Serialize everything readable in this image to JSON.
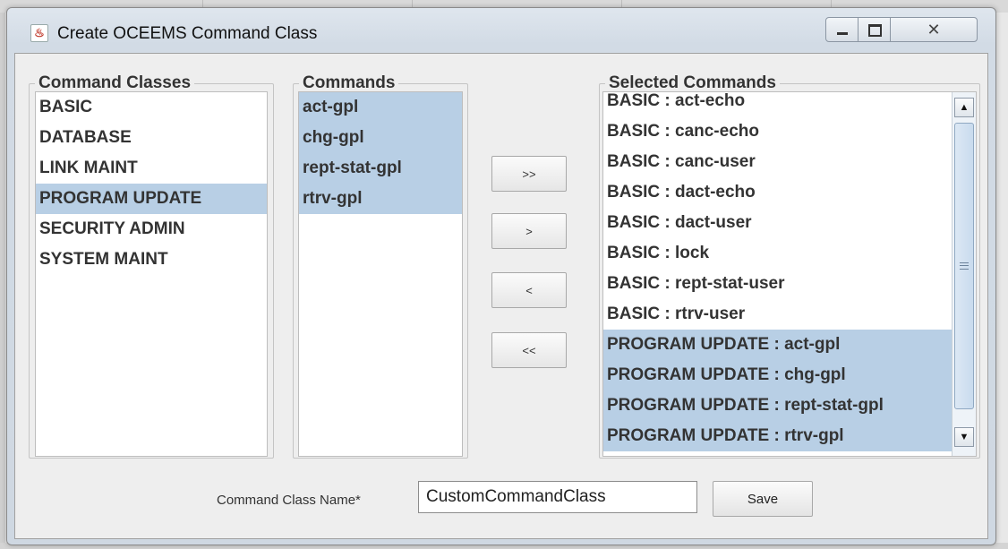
{
  "window": {
    "title": "Create OCEEMS Command Class",
    "app_icon": "java-cup-icon",
    "controls": {
      "minimize": "minimize-icon",
      "maximize": "maximize-icon",
      "close": "close-icon"
    }
  },
  "command_classes": {
    "legend": "Command Classes",
    "items": [
      {
        "label": "BASIC",
        "selected": false
      },
      {
        "label": "DATABASE",
        "selected": false
      },
      {
        "label": "LINK MAINT",
        "selected": false
      },
      {
        "label": "PROGRAM UPDATE",
        "selected": true
      },
      {
        "label": "SECURITY ADMIN",
        "selected": false
      },
      {
        "label": "SYSTEM MAINT",
        "selected": false
      }
    ]
  },
  "commands": {
    "legend": "Commands",
    "items": [
      {
        "label": "act-gpl",
        "selected": true
      },
      {
        "label": "chg-gpl",
        "selected": true
      },
      {
        "label": "rept-stat-gpl",
        "selected": true
      },
      {
        "label": "rtrv-gpl",
        "selected": true
      }
    ]
  },
  "move_buttons": {
    "add_all": ">>",
    "add": ">",
    "remove": "<",
    "remove_all": "<<"
  },
  "selected_commands": {
    "legend": "Selected Commands",
    "items": [
      {
        "label": "BASIC : act-echo",
        "selected": false
      },
      {
        "label": "BASIC : canc-echo",
        "selected": false
      },
      {
        "label": "BASIC : canc-user",
        "selected": false
      },
      {
        "label": "BASIC : dact-echo",
        "selected": false
      },
      {
        "label": "BASIC : dact-user",
        "selected": false
      },
      {
        "label": "BASIC : lock",
        "selected": false
      },
      {
        "label": "BASIC : rept-stat-user",
        "selected": false
      },
      {
        "label": "BASIC : rtrv-user",
        "selected": false
      },
      {
        "label": "PROGRAM UPDATE : act-gpl",
        "selected": true
      },
      {
        "label": "PROGRAM UPDATE : chg-gpl",
        "selected": true
      },
      {
        "label": "PROGRAM UPDATE : rept-stat-gpl",
        "selected": true
      },
      {
        "label": "PROGRAM UPDATE : rtrv-gpl",
        "selected": true
      }
    ]
  },
  "form": {
    "name_label": "Command Class Name*",
    "name_value": "CustomCommandClass",
    "save_label": "Save"
  },
  "colors": {
    "selection": "#b8cfe5",
    "panel": "#eeeeee",
    "title_gradient_top": "#dfe6ee"
  }
}
